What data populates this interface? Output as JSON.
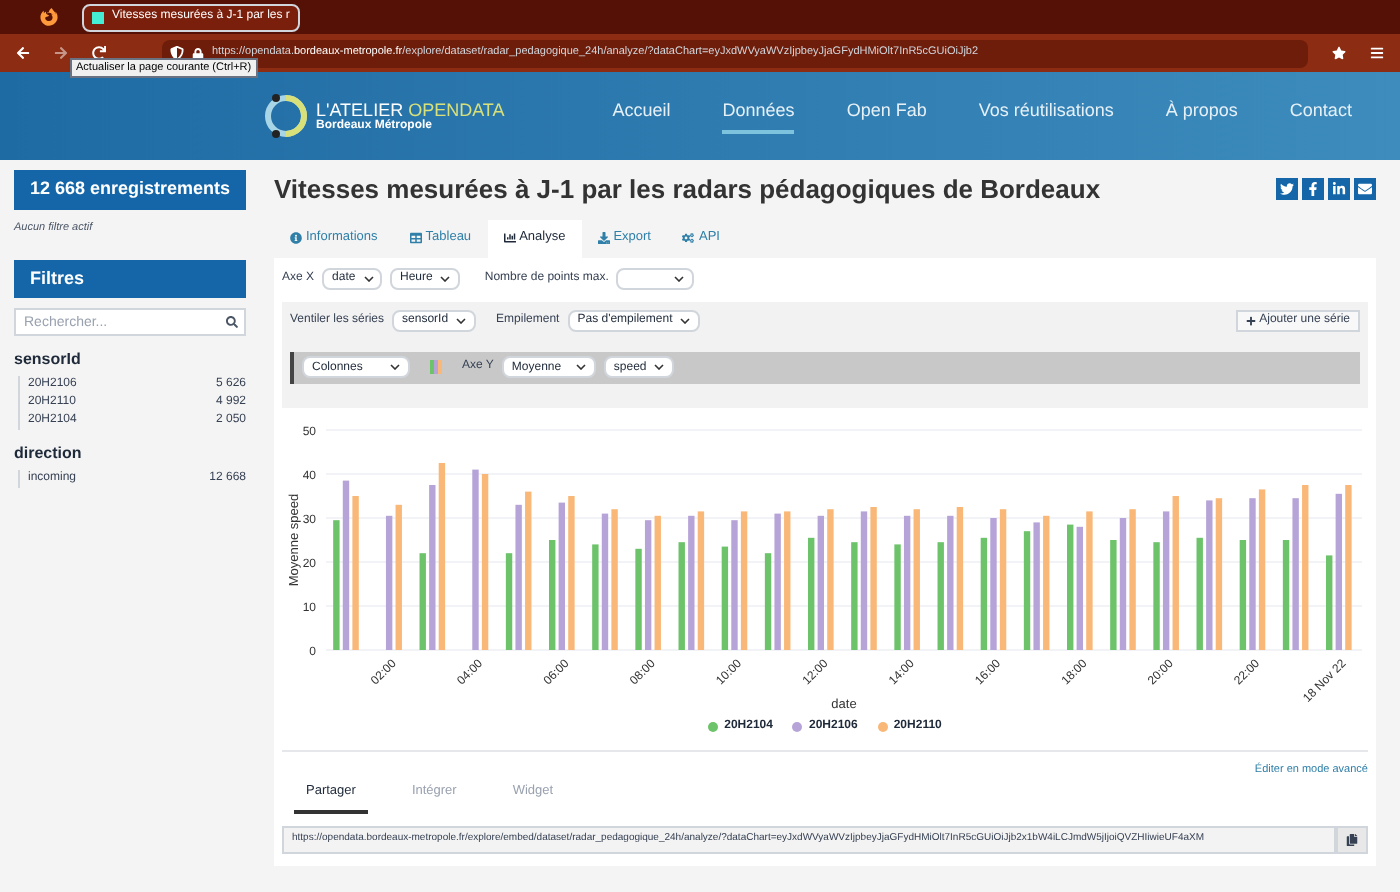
{
  "browser": {
    "tab_title": "Vitesses mesurées à J-1 par les r",
    "url_prefix": "https://opendata.",
    "url_domain": "bordeaux-metropole.fr",
    "url_rest": "/explore/dataset/radar_pedagogique_24h/analyze/?dataChart=eyJxdWVyaWVzIjpbeyJjaGFydHMiOlt7InR5cGUiOiJjb2",
    "tooltip": "Actualiser la page courante (Ctrl+R)"
  },
  "site": {
    "logo_title": "L'ATELIER ",
    "logo_accent": "OPENDATA",
    "logo_subtitle": "Bordeaux Métropole",
    "nav": [
      {
        "label": "Accueil",
        "selected": false
      },
      {
        "label": "Données",
        "selected": true
      },
      {
        "label": "Open Fab",
        "selected": false
      },
      {
        "label": "Vos réutilisations",
        "selected": false
      },
      {
        "label": "À propos",
        "selected": false
      },
      {
        "label": "Contact",
        "selected": false
      }
    ]
  },
  "sidebar": {
    "records": "12 668 enregistrements",
    "no_filter": "Aucun filtre actif",
    "filters_title": "Filtres",
    "search_placeholder": "Rechercher...",
    "facets": [
      {
        "name": "sensorId",
        "items": [
          {
            "label": "20H2106",
            "count": "5 626"
          },
          {
            "label": "20H2110",
            "count": "4 992"
          },
          {
            "label": "20H2104",
            "count": "2 050"
          }
        ]
      },
      {
        "name": "direction",
        "items": [
          {
            "label": "incoming",
            "count": "12 668"
          }
        ]
      }
    ]
  },
  "page": {
    "title": "Vitesses mesurées à J-1 par les radars pédagogiques de Bordeaux",
    "tabs": [
      {
        "label": "Informations",
        "kind": "info",
        "selected": false
      },
      {
        "label": "Tableau",
        "kind": "table",
        "selected": false
      },
      {
        "label": "Analyse",
        "kind": "chart",
        "selected": true
      },
      {
        "label": "Export",
        "kind": "download",
        "selected": false
      },
      {
        "label": "API",
        "kind": "cogs",
        "selected": false
      }
    ]
  },
  "controls": {
    "axis_x_label": "Axe X",
    "axis_x_field": "date",
    "axis_x_unit": "Heure",
    "max_points_label": "Nombre de points max.",
    "split_label": "Ventiler les séries",
    "split_value": "sensorId",
    "stack_label": "Empilement",
    "stack_value": "Pas d'empilement",
    "add_series": "Ajouter une série",
    "chart_type": "Colonnes",
    "axis_y_label": "Axe Y",
    "axis_y_agg": "Moyenne",
    "axis_y_field": "speed"
  },
  "chart": {
    "chart_data": {
      "type": "bar",
      "xlabel": "date",
      "ylabel": "Moyenne speed",
      "categories": [
        null,
        "02:00",
        null,
        "04:00",
        null,
        "06:00",
        null,
        "08:00",
        null,
        "10:00",
        null,
        "12:00",
        null,
        "14:00",
        null,
        "16:00",
        null,
        "18:00",
        null,
        "20:00",
        null,
        "22:00",
        null,
        "18 Nov 22"
      ],
      "series": [
        {
          "name": "20H2104",
          "color": "#6cc36a",
          "values": [
            29.5,
            null,
            22,
            null,
            22,
            25,
            24,
            23,
            24.5,
            23.5,
            22,
            25.5,
            24.5,
            24,
            24.5,
            25.5,
            27,
            28.5,
            25,
            24.5,
            25.5,
            25,
            25,
            21.5
          ]
        },
        {
          "name": "20H2106",
          "color": "#b6a4d8",
          "values": [
            38.5,
            30.5,
            37.5,
            41,
            33,
            33.5,
            31,
            29.5,
            30.5,
            29.5,
            31,
            30.5,
            31.5,
            30.5,
            30.5,
            30,
            29,
            28,
            30,
            31.5,
            34,
            34.5,
            34.5,
            35.5
          ]
        },
        {
          "name": "20H2110",
          "color": "#f9b878",
          "values": [
            35,
            33,
            42.5,
            40,
            36,
            35,
            32,
            30.5,
            31.5,
            31.5,
            31.5,
            32,
            32.5,
            32,
            32.5,
            32,
            30.5,
            31.5,
            32,
            35,
            34.5,
            36.5,
            37.5,
            37.5
          ]
        }
      ],
      "ylim": [
        0,
        50
      ],
      "yticks": [
        0,
        10,
        20,
        30,
        40,
        50
      ],
      "grid": true
    }
  },
  "advanced_link": "Éditer en mode avancé",
  "share": {
    "tabs": [
      {
        "label": "Partager",
        "selected": true
      },
      {
        "label": "Intégrer",
        "selected": false
      },
      {
        "label": "Widget",
        "selected": false
      }
    ],
    "url": "https://opendata.bordeaux-metropole.fr/explore/embed/dataset/radar_pedagogique_24h/analyze/?dataChart=eyJxdWVyaWVzIjpbeyJjaGFydHMiOlt7InR5cGUiOiJjb2x1bW4iLCJmdW5jIjoiQVZHIiwieUF4aXM"
  }
}
